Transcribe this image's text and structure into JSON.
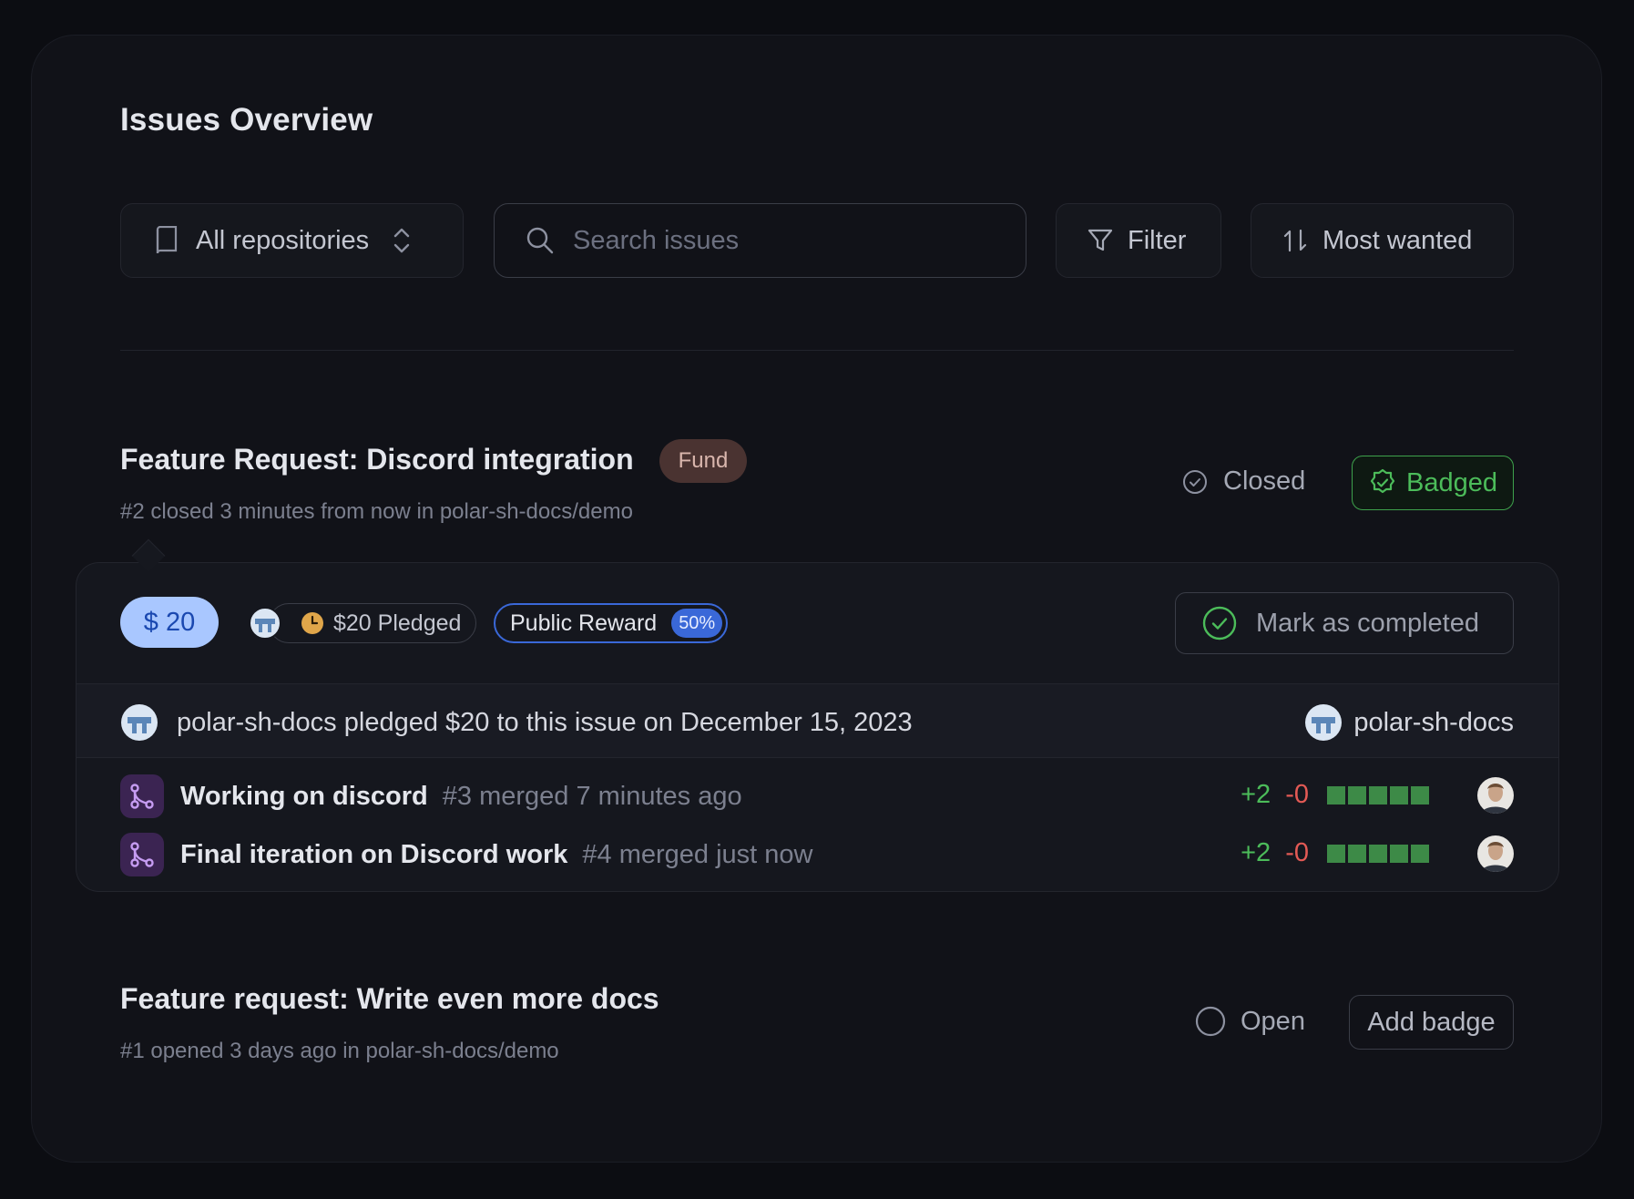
{
  "page": {
    "title": "Issues Overview"
  },
  "toolbar": {
    "repo_label": "All repositories",
    "search_placeholder": "Search issues",
    "filter_label": "Filter",
    "sort_label": "Most wanted"
  },
  "issues": [
    {
      "title": "Feature Request: Discord integration",
      "fund_label": "Fund",
      "meta": "#2 closed 3 minutes from now in polar-sh-docs/demo",
      "status": "Closed",
      "badge_label": "Badged",
      "amount": "$ 20",
      "pledged_label": "$20 Pledged",
      "reward_label": "Public Reward",
      "reward_pct": "50%",
      "complete_label": "Mark as completed",
      "pledge_text": "polar-sh-docs pledged $20 to this issue on December 15, 2023",
      "pledger": "polar-sh-docs",
      "prs": [
        {
          "title": "Working on discord",
          "meta": "#3 merged 7 minutes ago",
          "additions": "+2",
          "deletions": "-0"
        },
        {
          "title": "Final iteration on Discord work",
          "meta": "#4 merged just now",
          "additions": "+2",
          "deletions": "-0"
        }
      ]
    },
    {
      "title": "Feature request: Write even more docs",
      "meta": "#1 opened 3 days ago in polar-sh-docs/demo",
      "status": "Open",
      "badge_label": "Add badge"
    }
  ],
  "icons": {
    "repo": "book-icon",
    "chevron": "chevron-up-down-icon",
    "search": "search-icon",
    "filter": "funnel-icon",
    "sort": "sort-arrows-icon",
    "closed": "check-circle-icon",
    "badged": "badge-check-icon",
    "complete": "check-circle-icon",
    "pr": "git-merge-icon",
    "open": "circle-icon"
  },
  "colors": {
    "accent_blue": "#3a68d8",
    "green": "#4cbc5a",
    "red": "#e35a55",
    "pr_purple": "#3b2452"
  }
}
